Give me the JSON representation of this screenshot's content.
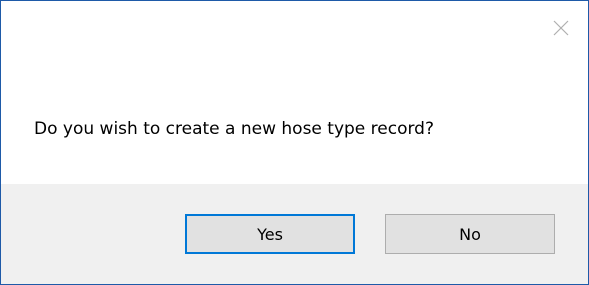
{
  "dialog": {
    "message": "Do you wish to create a new hose type record?",
    "close_icon": "close-icon",
    "buttons": {
      "yes_label": "Yes",
      "no_label": "No"
    },
    "colors": {
      "border": "#1e5aa8",
      "footer_background": "#f0f0f0",
      "button_background": "#e1e1e1",
      "default_button_border": "#0078d7"
    }
  }
}
